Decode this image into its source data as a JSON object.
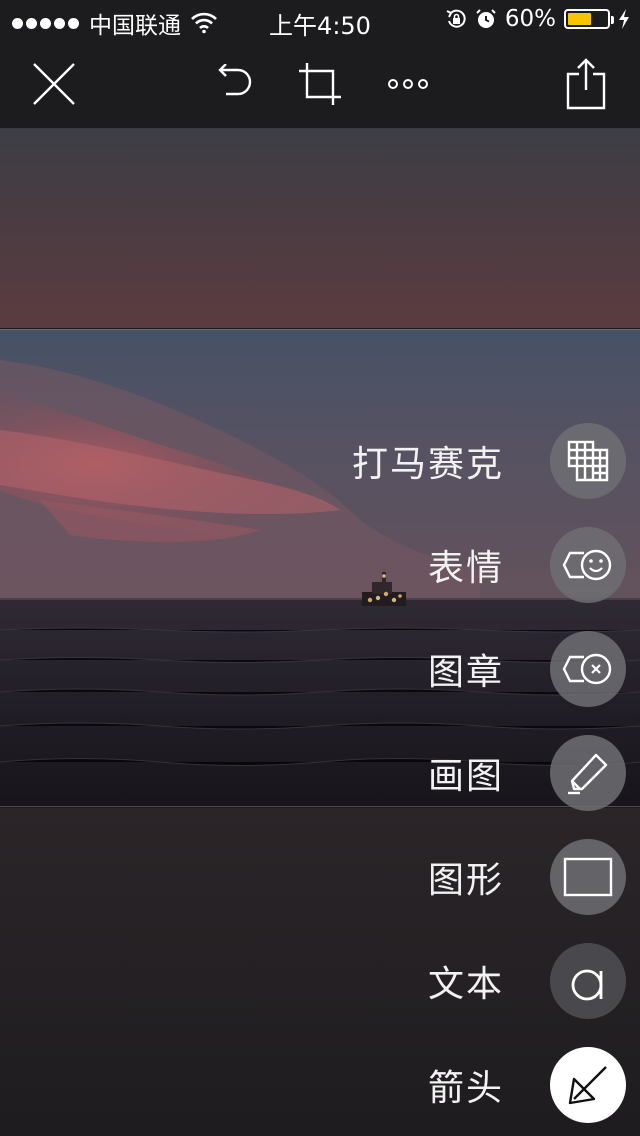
{
  "status_bar": {
    "carrier": "中国联通",
    "time": "上午4:50",
    "battery_percent": "60%",
    "battery_level": 0.6,
    "battery_color": "#f7c600",
    "icons": [
      "signal-dots-icon",
      "wifi-icon",
      "rotation-lock-icon",
      "alarm-icon",
      "battery-icon",
      "charging-bolt-icon"
    ]
  },
  "toolbar": {
    "close": "close-icon",
    "undo": "undo-icon",
    "crop": "crop-icon",
    "more": "more-icon",
    "share": "share-icon"
  },
  "tools": [
    {
      "label": "打马赛克",
      "icon": "mosaic-grid-icon"
    },
    {
      "label": "表情",
      "icon": "emoji-sticker-icon"
    },
    {
      "label": "图章",
      "icon": "stamp-icon"
    },
    {
      "label": "画图",
      "icon": "pen-icon"
    },
    {
      "label": "图形",
      "icon": "rectangle-shape-icon"
    },
    {
      "label": "文本",
      "icon": "text-a-icon"
    },
    {
      "label": "箭头",
      "icon": "arrow-icon",
      "active": true
    }
  ]
}
